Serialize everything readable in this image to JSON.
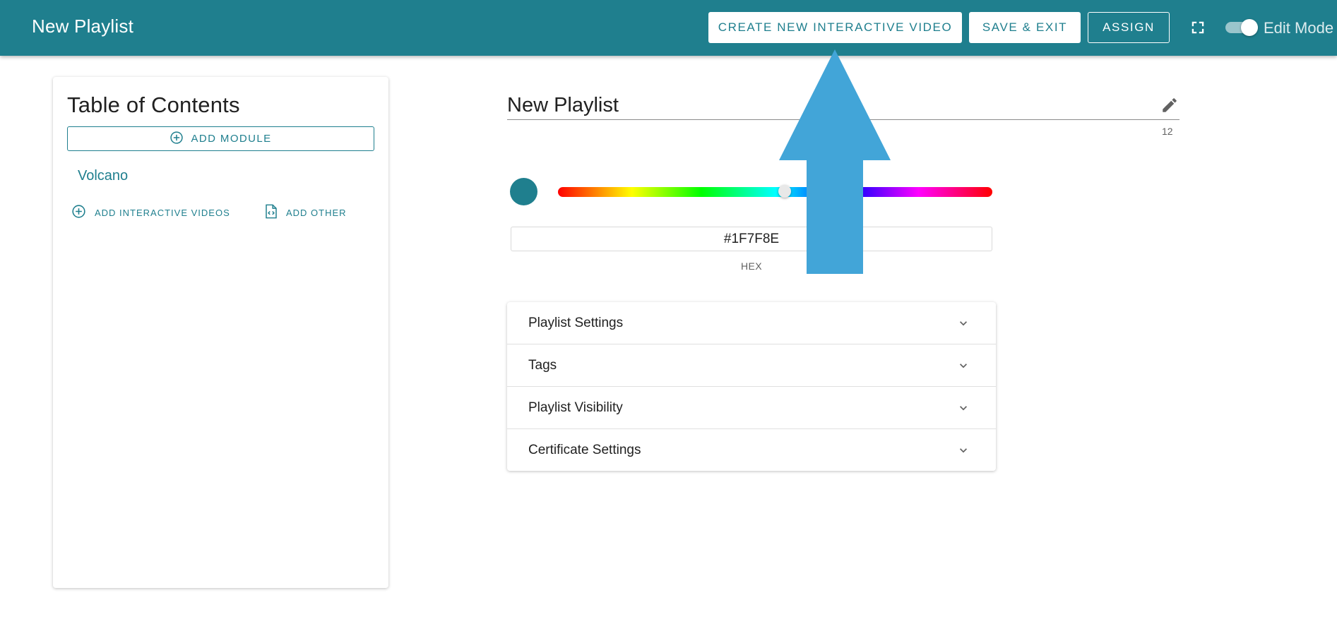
{
  "header": {
    "title": "New Playlist",
    "create_label": "CREATE NEW INTERACTIVE VIDEO",
    "save_label": "SAVE & EXIT",
    "assign_label": "ASSIGN",
    "fullscreen_icon": "fullscreen-icon",
    "edit_mode_label": "Edit Mode",
    "edit_mode_on": true
  },
  "toc": {
    "title": "Table of Contents",
    "add_module_label": "ADD MODULE",
    "modules": [
      {
        "name": "Volcano"
      }
    ],
    "add_videos_label": "ADD INTERACTIVE VIDEOS",
    "add_other_label": "ADD OTHER"
  },
  "editor": {
    "playlist_title": "New Playlist",
    "char_count": "12",
    "color_hex": "#1F7F8E",
    "hex_label": "HEX",
    "hue_fraction": 0.52
  },
  "accordion": {
    "items": [
      {
        "label": "Playlist Settings"
      },
      {
        "label": "Tags"
      },
      {
        "label": "Playlist Visibility"
      },
      {
        "label": "Certificate Settings"
      }
    ]
  },
  "colors": {
    "primary": "#1f7f8e",
    "annotation_arrow": "#42a5d8"
  }
}
